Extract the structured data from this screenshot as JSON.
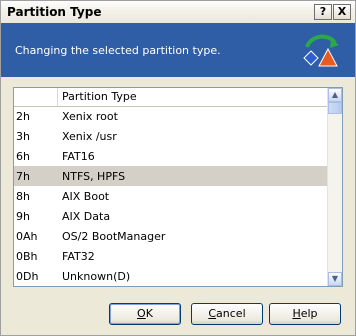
{
  "window": {
    "title": "Partition Type",
    "help_glyph": "?",
    "close_glyph": "X"
  },
  "header": {
    "description": "Changing the selected partition type.",
    "icon": "partition-shapes-icon"
  },
  "list": {
    "column_id": "",
    "column_type": "Partition Type",
    "selected_index": 3,
    "rows": [
      {
        "id": "2h",
        "type": "Xenix root"
      },
      {
        "id": "3h",
        "type": "Xenix /usr"
      },
      {
        "id": "6h",
        "type": "FAT16"
      },
      {
        "id": "7h",
        "type": "NTFS, HPFS"
      },
      {
        "id": "8h",
        "type": "AIX Boot"
      },
      {
        "id": "9h",
        "type": "AIX Data"
      },
      {
        "id": "0Ah",
        "type": "OS/2 BootManager"
      },
      {
        "id": "0Bh",
        "type": "FAT32"
      },
      {
        "id": "0Dh",
        "type": "Unknown(D)"
      }
    ]
  },
  "buttons": {
    "ok": {
      "first": "O",
      "rest": "K"
    },
    "cancel": {
      "first": "C",
      "rest": "ancel"
    },
    "help": {
      "first": "H",
      "rest": "elp"
    }
  },
  "colors": {
    "header_blue": "#2f5ea6",
    "selection_gray": "#d4d0c8",
    "dialog_face": "#ece9d8"
  }
}
